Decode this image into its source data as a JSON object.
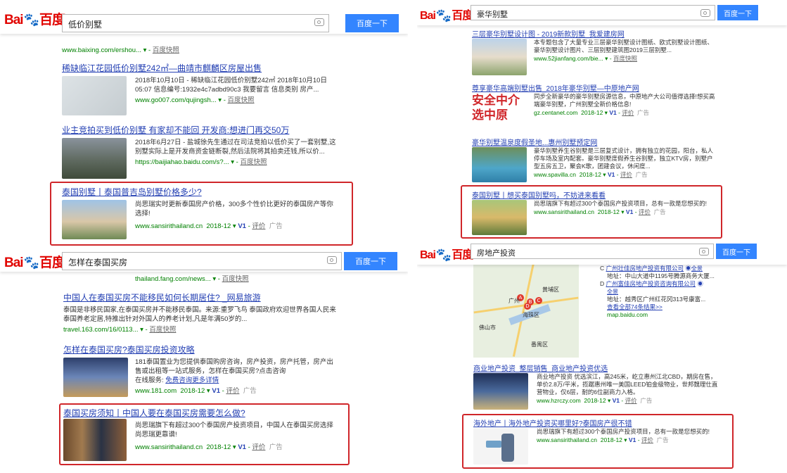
{
  "brand": {
    "bai": "Bai",
    "du": "度",
    "baidu": "百度"
  },
  "button_label": "百度一下",
  "panels": {
    "p1": {
      "query": "低价别墅",
      "results": [
        {
          "url": "www.baixing.com/ershou...",
          "kz": "百度快照"
        },
        {
          "title": "稀缺临江花园低价别墅242㎡—曲靖市麒麟区房屋出售",
          "desc1": "2018年10月10日 - 稀缺临江花园低价别墅242㎡ 2018年10月10日",
          "desc2": "05:07 信息编号:1932e4c7adbd90c3 我要留言 信息类别 房产...",
          "url": "www.go007.com/qujingsh...",
          "kz": "百度快照"
        },
        {
          "title": "业主竞拍买到低价别墅 有家却不能回 开发商:想进门再交50万",
          "desc1": "2018年6月27日 - 盐城徐先生通过在司法竞拍以低价买了一套别墅,这",
          "desc2": "别墅实际上是开发商资金链断裂,然后法院将其拍卖还钱,所以价...",
          "url": "https://baijiahao.baidu.com/s?...",
          "kz": "百度快照"
        },
        {
          "title": "泰国别墅丨泰国普吉岛别墅价格多少?",
          "desc1": "尚思瑞实时更新泰国房产价格，300多个性价比更好的泰国房产等你",
          "desc2": "选择!",
          "url": "www.sansirithailand.cn",
          "date": "2018-12",
          "kz": "评价",
          "ad": "广告"
        }
      ]
    },
    "p2": {
      "query": "豪华别墅",
      "results": [
        {
          "title": "三层豪华别墅设计图 - 2019新款别墅_我爱建房网",
          "desc1": "本专题包含了大量专业三层豪华别墅设计图纸、欧式别墅设计图纸、",
          "desc2": "豪华别墅设计图片、三层别墅建筑图2019三层别墅...",
          "url": "www.52jianfang.com/bie...",
          "kz": "百度快照"
        },
        {
          "title": "尊享豪华高端别墅出售_2018年豪华别墅—中原地产网",
          "desc1": "同步全新豪华的豪华别墅房源信息，中原地产大公司值得选择!想买高",
          "desc2": "端豪华别墅，广州别墅全新价格信息!",
          "url": "gz.centanet.com",
          "date": "2018-12",
          "kz": "评价",
          "ad": "广告",
          "img_text1": "安全中介",
          "img_text2": "选中原"
        },
        {
          "title": "豪华别墅温泉度假圣地...惠州别墅预定网",
          "desc1": "豪华别墅养生谷别墅是三层复式设计，拥有独立的花园，阳台，私人",
          "desc2": "停车场及室内配套。豪华别墅度假养生谷别墅，独立KTV房，别墅户",
          "desc3": "型五房五卫，聚会K歌，团建会议，休闲度...",
          "url": "www.spavilla.cn",
          "date": "2018-12",
          "kz": "评价",
          "ad": "广告"
        },
        {
          "title": "泰国别墅丨想买泰国别墅吗，不妨进来看看",
          "desc1": "尚思瑞旗下有超过300个泰国房产投资项目，总有一款是您想买的!",
          "url": "www.sansirithailand.cn",
          "date": "2018-12",
          "kz": "评价",
          "ad": "广告"
        }
      ]
    },
    "p3": {
      "query": "怎样在泰国买房",
      "results": [
        {
          "url": "thailand.fang.com/news...",
          "kz": "百度快照"
        },
        {
          "title": "中国人在泰国买房不能移民如何长期居住? _网易旅游",
          "desc1": "泰国是非移民国家,在泰国买房并不能移民泰国。来源:重罗飞鸟 泰国政府欢迎世界各国人民来",
          "desc2": "泰国养老定居,特推出针对外国人的养老计划,凡是年满50岁的...",
          "url": "travel.163.com/16/0113...",
          "kz": "百度快照"
        },
        {
          "title": "怎样在泰国买房?泰国买房投资攻略",
          "desc1": "181泰国置业为您提供泰国购房咨询，房产投资，房产托管，房产出",
          "desc2": "售或出租等一站式服务，怎样在泰国买房?点击咨询",
          "desc3": "在线服务:",
          "link": "免费咨询更多详情",
          "url": "www.181.com",
          "date": "2018-12",
          "kz": "评价",
          "ad": "广告"
        },
        {
          "title": "泰国买房须知丨中国人要在泰国买房需要怎么做?",
          "desc1": "尚思瑞旗下有超过300个泰国房产投资项目，中国人在泰国买房选择",
          "desc2": "尚思瑞更靠谱!",
          "url": "www.sansirithailand.cn",
          "date": "2018-12",
          "kz": "评价",
          "ad": "广告"
        }
      ]
    },
    "p4": {
      "query": "房地产投资",
      "map": {
        "items": [
          {
            "letter": "C",
            "name": "广州壮佳房地产投资有限公司",
            "tag": "全景",
            "addr": "地址：中山大道中1195号腾源商务大厦..."
          },
          {
            "letter": "D",
            "name": "广州富佳房地产投资咨询有限公司",
            "tag": "全景",
            "addr": "地址：越秀区广州红花冈313号康富..."
          }
        ],
        "more": "查看全部74条结果>>",
        "url": "map.baidu.com",
        "labels": [
          "黄埔区",
          "海珠区",
          "佛山市",
          "番禺区",
          "广州"
        ]
      },
      "results": [
        {
          "title": "商业地产投资_整层销售_商业地产投资优选",
          "desc1": "商业地产投资 优选滨江，高245米，屹立惠州江北CBD，期房在售，",
          "desc2": "单价2.8万/平米，揽踞惠州唯一美国LEED铂金级物业，世邦魏理仕直",
          "desc3": "营物业，仅6层，耐的6位副商力入格。",
          "url": "www.hzrczy.com",
          "date": "2018-12",
          "kz": "评价",
          "ad": "广告"
        },
        {
          "title": "海外地产丨海外地产投资买哪里好?泰国房产很不错",
          "desc1": "尚思瑞旗下有超过300个泰国房产投资项目，总有一款是您想买的!",
          "url": "www.sansirithailand.cn",
          "date": "2018-12",
          "kz": "评价",
          "ad": "广告"
        }
      ]
    }
  },
  "v1": "V1"
}
